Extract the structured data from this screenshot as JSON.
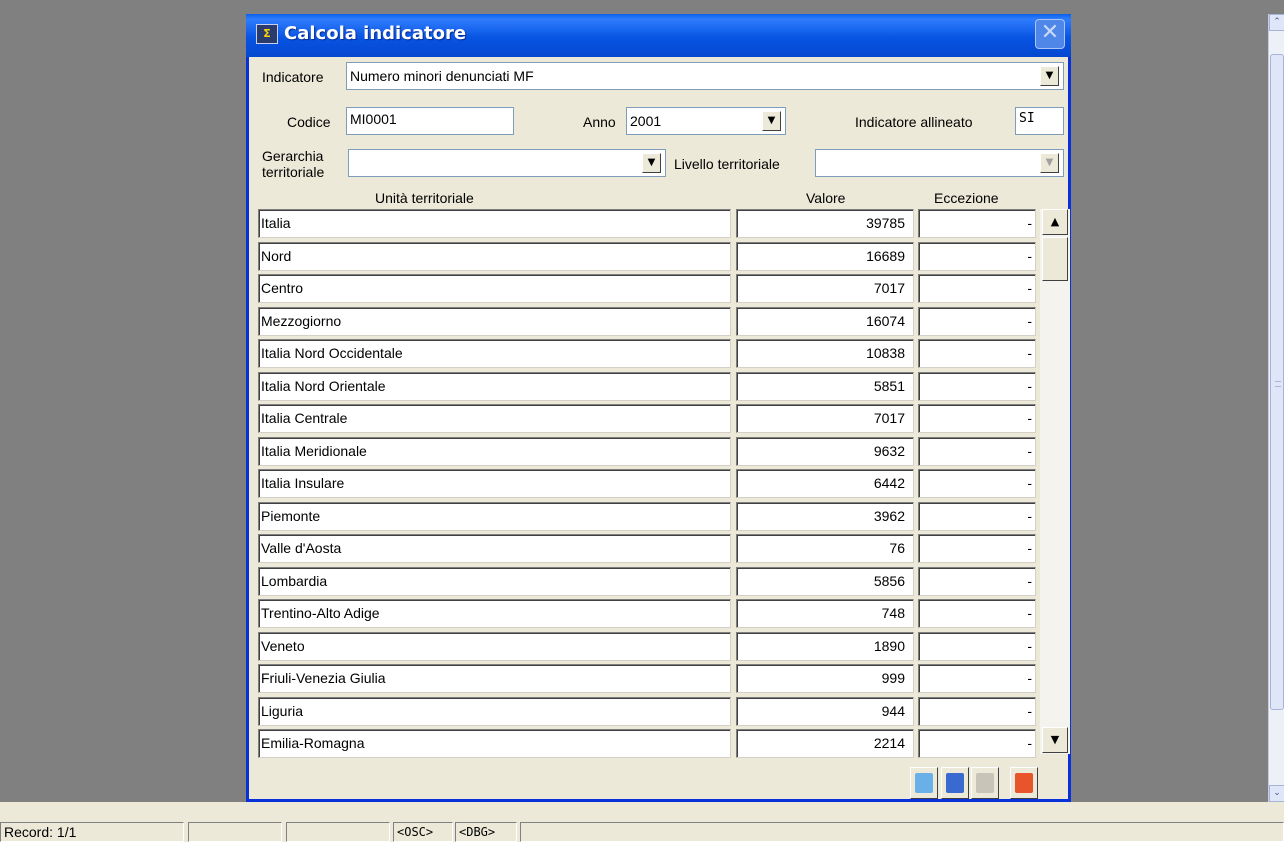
{
  "window": {
    "title": "Calcola indicatore",
    "close": "✕"
  },
  "indicatore": {
    "label": "Indicatore",
    "value": "Numero minori denunciati MF"
  },
  "codice": {
    "label": "Codice",
    "value": "MI0001"
  },
  "anno": {
    "label": "Anno",
    "value": "2001"
  },
  "allineato": {
    "label": "Indicatore allineato",
    "value": "SI"
  },
  "gerarchia": {
    "label_line1": "Gerarchia",
    "label_line2": "territoriale",
    "value": ""
  },
  "livello": {
    "label": "Livello territoriale",
    "value": ""
  },
  "grid": {
    "headers": {
      "unit": "Unità territoriale",
      "value": "Valore",
      "exception": "Eccezione"
    },
    "rows": [
      {
        "unit": "Italia",
        "value": "39785",
        "exception": "-"
      },
      {
        "unit": "Nord",
        "value": "16689",
        "exception": "-"
      },
      {
        "unit": "Centro",
        "value": "7017",
        "exception": "-"
      },
      {
        "unit": "Mezzogiorno",
        "value": "16074",
        "exception": "-"
      },
      {
        "unit": "Italia Nord Occidentale",
        "value": "10838",
        "exception": "-"
      },
      {
        "unit": "Italia Nord Orientale",
        "value": "5851",
        "exception": "-"
      },
      {
        "unit": "Italia Centrale",
        "value": "7017",
        "exception": "-"
      },
      {
        "unit": "Italia Meridionale",
        "value": "9632",
        "exception": "-"
      },
      {
        "unit": "Italia Insulare",
        "value": "6442",
        "exception": "-"
      },
      {
        "unit": "Piemonte",
        "value": "3962",
        "exception": "-"
      },
      {
        "unit": "Valle d'Aosta",
        "value": "76",
        "exception": "-"
      },
      {
        "unit": "Lombardia",
        "value": "5856",
        "exception": "-"
      },
      {
        "unit": "Trentino-Alto Adige",
        "value": "748",
        "exception": "-"
      },
      {
        "unit": "Veneto",
        "value": "1890",
        "exception": "-"
      },
      {
        "unit": "Friuli-Venezia Giulia",
        "value": "999",
        "exception": "-"
      },
      {
        "unit": "Liguria",
        "value": "944",
        "exception": "-"
      },
      {
        "unit": "Emilia-Romagna",
        "value": "2214",
        "exception": "-"
      }
    ]
  },
  "icons": {
    "dropdown": "▼",
    "scroll_up": "▲",
    "scroll_down": "▼",
    "app_up": "⌃",
    "app_down": "⌄"
  },
  "toolbar": {
    "buttons": [
      {
        "name": "calculate-icon",
        "color": "#6ab0e8"
      },
      {
        "name": "grid-icon",
        "color": "#3a6ad0"
      },
      {
        "name": "save-icon",
        "color": "#c8c4b8"
      },
      {
        "name": "exit-icon",
        "color": "#e8542c"
      }
    ]
  },
  "statusbar": {
    "record": "Record: 1/1",
    "osc": "<OSC>",
    "dbg": "<DBG>"
  }
}
